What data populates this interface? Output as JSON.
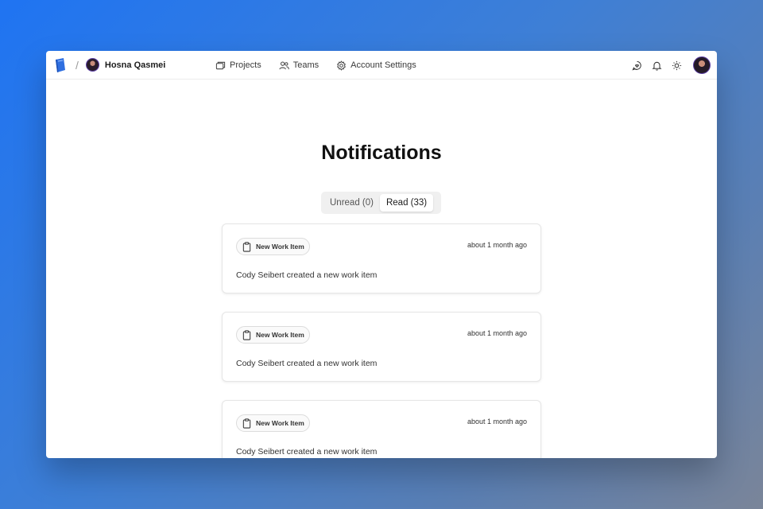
{
  "header": {
    "user_name": "Hosna Qasmei",
    "nav": [
      {
        "label": "Projects",
        "icon": "folders-icon"
      },
      {
        "label": "Teams",
        "icon": "users-icon"
      },
      {
        "label": "Account Settings",
        "icon": "gear-icon"
      }
    ],
    "right_icons": [
      "chat-icon",
      "bell-icon",
      "sun-icon"
    ]
  },
  "page": {
    "title": "Notifications",
    "tabs": [
      {
        "label": "Unread (0)",
        "active": false
      },
      {
        "label": "Read (33)",
        "active": true
      }
    ]
  },
  "notifications": [
    {
      "badge": "New Work Item",
      "time": "about 1 month ago",
      "message": "Cody Seibert created a new work item"
    },
    {
      "badge": "New Work Item",
      "time": "about 1 month ago",
      "message": "Cody Seibert created a new work item"
    },
    {
      "badge": "New Work Item",
      "time": "about 1 month ago",
      "message": "Cody Seibert created a new work item"
    }
  ],
  "colors": {
    "brand": "#2f6fe0",
    "avatar_ring": "#5b3fa3"
  }
}
